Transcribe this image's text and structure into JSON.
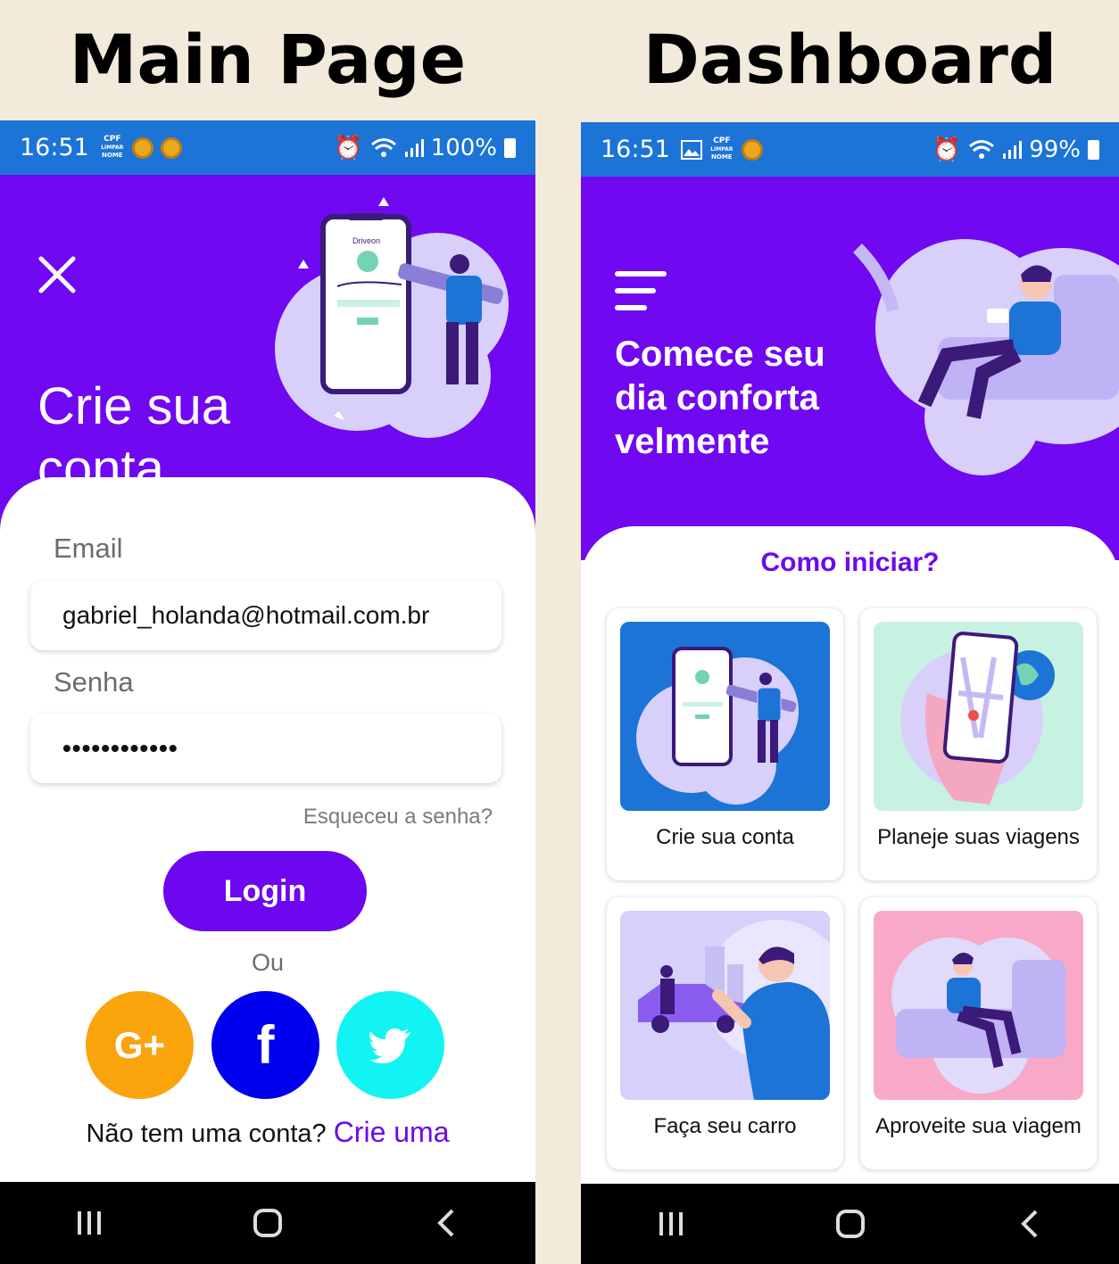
{
  "headings": {
    "main": "Main Page",
    "dashboard": "Dashboard"
  },
  "main": {
    "status": {
      "time": "16:51",
      "cpf": [
        "CPF",
        "LIMPAR",
        "NOME"
      ],
      "battery": "100%"
    },
    "hero_title": "Crie sua conta",
    "email_label": "Email",
    "email_value": "gabriel_holanda@hotmail.com.br",
    "password_label": "Senha",
    "password_value": "••••••••••••",
    "forgot": "Esqueceu a senha?",
    "login": "Login",
    "or": "Ou",
    "google": "G+",
    "facebook": "f",
    "signup_text": "Não tem uma conta?",
    "signup_link": "Crie uma",
    "illustration_brand": "Driveon"
  },
  "dashboard": {
    "status": {
      "time": "16:51",
      "cpf": [
        "CPF",
        "LIMPAR",
        "NOME"
      ],
      "battery": "99%"
    },
    "hero_title": "Comece seu dia conforta velmente",
    "section_title": "Como iniciar?",
    "tiles": [
      {
        "label": "Crie sua conta",
        "bg": "#1c74d6"
      },
      {
        "label": "Planeje suas viagens",
        "bg": "#c7f2e2"
      },
      {
        "label": "Faça seu carro",
        "bg": "#d6d1fa"
      },
      {
        "label": "Aproveite sua viagem",
        "bg": "#f8a9c8"
      }
    ]
  },
  "colors": {
    "status_bar": "#1c74d6",
    "hero": "#7008f1",
    "accent": "#6c07ef",
    "google": "#faa40c",
    "facebook": "#0000ee",
    "twitter": "#12f4f3",
    "page_bg": "#f2eadb"
  }
}
